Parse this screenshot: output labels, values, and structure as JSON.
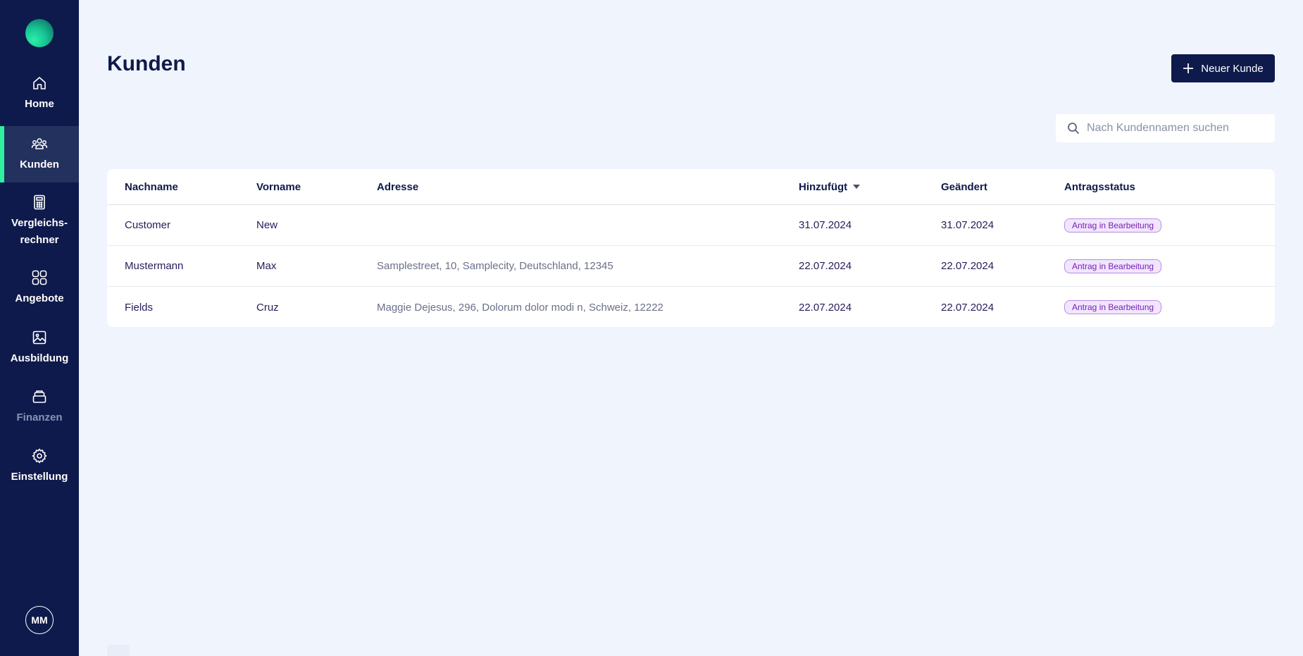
{
  "sidebar": {
    "items": [
      {
        "label": "Home",
        "icon": "home-icon"
      },
      {
        "label": "Kunden",
        "icon": "users-icon"
      },
      {
        "label": "Vergleichs-\nrechner",
        "icon": "calculator-icon"
      },
      {
        "label": "Angebote",
        "icon": "grid-icon"
      },
      {
        "label": "Ausbildung",
        "icon": "image-icon"
      },
      {
        "label": "Finanzen",
        "icon": "stack-icon"
      },
      {
        "label": "Einstellung",
        "icon": "gear-icon"
      }
    ],
    "avatar": "MM"
  },
  "main": {
    "title": "Kunden",
    "new_button_label": "Neuer Kunde",
    "search_placeholder": "Nach Kundennamen suchen"
  },
  "table": {
    "columns": [
      "Nachname",
      "Vorname",
      "Adresse",
      "Hinzufügt",
      "Geändert",
      "Antragsstatus"
    ],
    "rows": [
      {
        "nachname": "Customer",
        "vorname": "New",
        "adresse": "",
        "hinzugefuegt": "31.07.2024",
        "geaendert": "31.07.2024",
        "status": "Antrag in Bearbeitung"
      },
      {
        "nachname": "Mustermann",
        "vorname": "Max",
        "adresse": "Samplestreet, 10, Samplecity, Deutschland, 12345",
        "hinzugefuegt": "22.07.2024",
        "geaendert": "22.07.2024",
        "status": "Antrag in Bearbeitung"
      },
      {
        "nachname": "Fields",
        "vorname": "Cruz",
        "adresse": "Maggie Dejesus, 296, Dolorum dolor modi n, Schweiz, 12222",
        "hinzugefuegt": "22.07.2024",
        "geaendert": "22.07.2024",
        "status": "Antrag in Bearbeitung"
      }
    ]
  },
  "colors": {
    "sidebar_bg": "#0e1a4b",
    "active_accent": "#2ef0a0",
    "page_bg": "#f0f4fc",
    "badge_text": "#7a1fb0"
  }
}
